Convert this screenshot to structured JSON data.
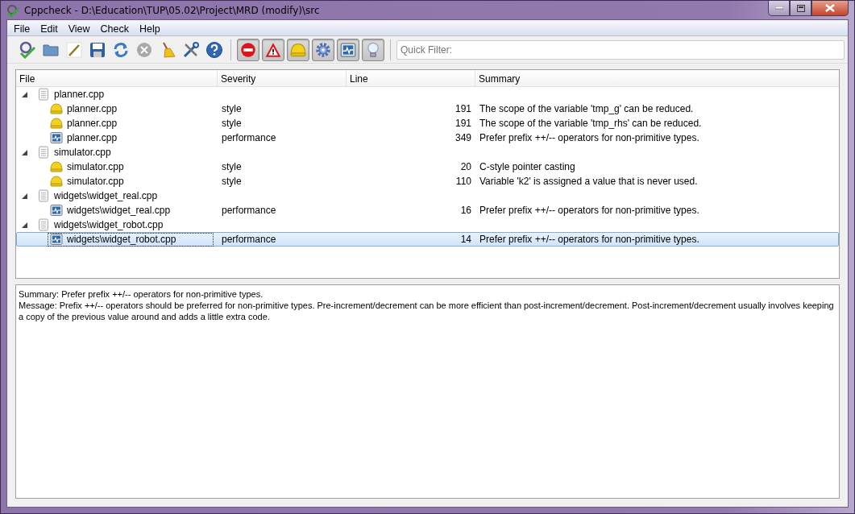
{
  "window": {
    "title": "Cppcheck - D:\\Education\\TUP\\05.02\\Project\\MRD (modify)\\src"
  },
  "menu": [
    {
      "label": "File"
    },
    {
      "label": "Edit"
    },
    {
      "label": "View"
    },
    {
      "label": "Check"
    },
    {
      "label": "Help"
    }
  ],
  "toolbar": {
    "filters": [
      {
        "kind": "error",
        "on": true
      },
      {
        "kind": "warning",
        "on": true
      },
      {
        "kind": "style",
        "on": true
      },
      {
        "kind": "portability",
        "on": true
      },
      {
        "kind": "performance",
        "on": true
      },
      {
        "kind": "information",
        "on": true
      }
    ],
    "filter_field": {
      "placeholder": "Quick Filter:"
    }
  },
  "table": {
    "columns": [
      "File",
      "Severity",
      "Line",
      "Summary"
    ],
    "files": [
      {
        "name": "planner.cpp",
        "expanded": true,
        "children": [
          {
            "kind": "style",
            "file": "planner.cpp",
            "severity": "style",
            "line": "191",
            "summary": "The scope of the variable 'tmp_g' can be reduced.",
            "selected": false
          },
          {
            "kind": "style",
            "file": "planner.cpp",
            "severity": "style",
            "line": "191",
            "summary": "The scope of the variable 'tmp_rhs' can be reduced.",
            "selected": false
          },
          {
            "kind": "performance",
            "file": "planner.cpp",
            "severity": "performance",
            "line": "349",
            "summary": "Prefer prefix ++/-- operators for non-primitive types.",
            "selected": false
          }
        ]
      },
      {
        "name": "simulator.cpp",
        "expanded": true,
        "children": [
          {
            "kind": "style",
            "file": "simulator.cpp",
            "severity": "style",
            "line": "20",
            "summary": "C-style pointer casting",
            "selected": false
          },
          {
            "kind": "style",
            "file": "simulator.cpp",
            "severity": "style",
            "line": "110",
            "summary": "Variable 'k2' is assigned a value that is never used.",
            "selected": false
          }
        ]
      },
      {
        "name": "widgets\\widget_real.cpp",
        "expanded": true,
        "children": [
          {
            "kind": "performance",
            "file": "widgets\\widget_real.cpp",
            "severity": "performance",
            "line": "16",
            "summary": "Prefer prefix ++/-- operators for non-primitive types.",
            "selected": false
          }
        ]
      },
      {
        "name": "widgets\\widget_robot.cpp",
        "expanded": true,
        "children": [
          {
            "kind": "performance",
            "file": "widgets\\widget_robot.cpp",
            "severity": "performance",
            "line": "14",
            "summary": "Prefer prefix ++/-- operators for non-primitive types.",
            "selected": true
          }
        ]
      }
    ]
  },
  "details": {
    "summary": "Summary: Prefer prefix ++/-- operators for non-primitive types.",
    "message": "Message: Prefix ++/-- operators should be preferred for non-primitive types. Pre-increment/decrement can be more efficient than post-increment/decrement. Post-increment/decrement usually involves keeping a copy of the previous value around and adds a little extra code."
  }
}
